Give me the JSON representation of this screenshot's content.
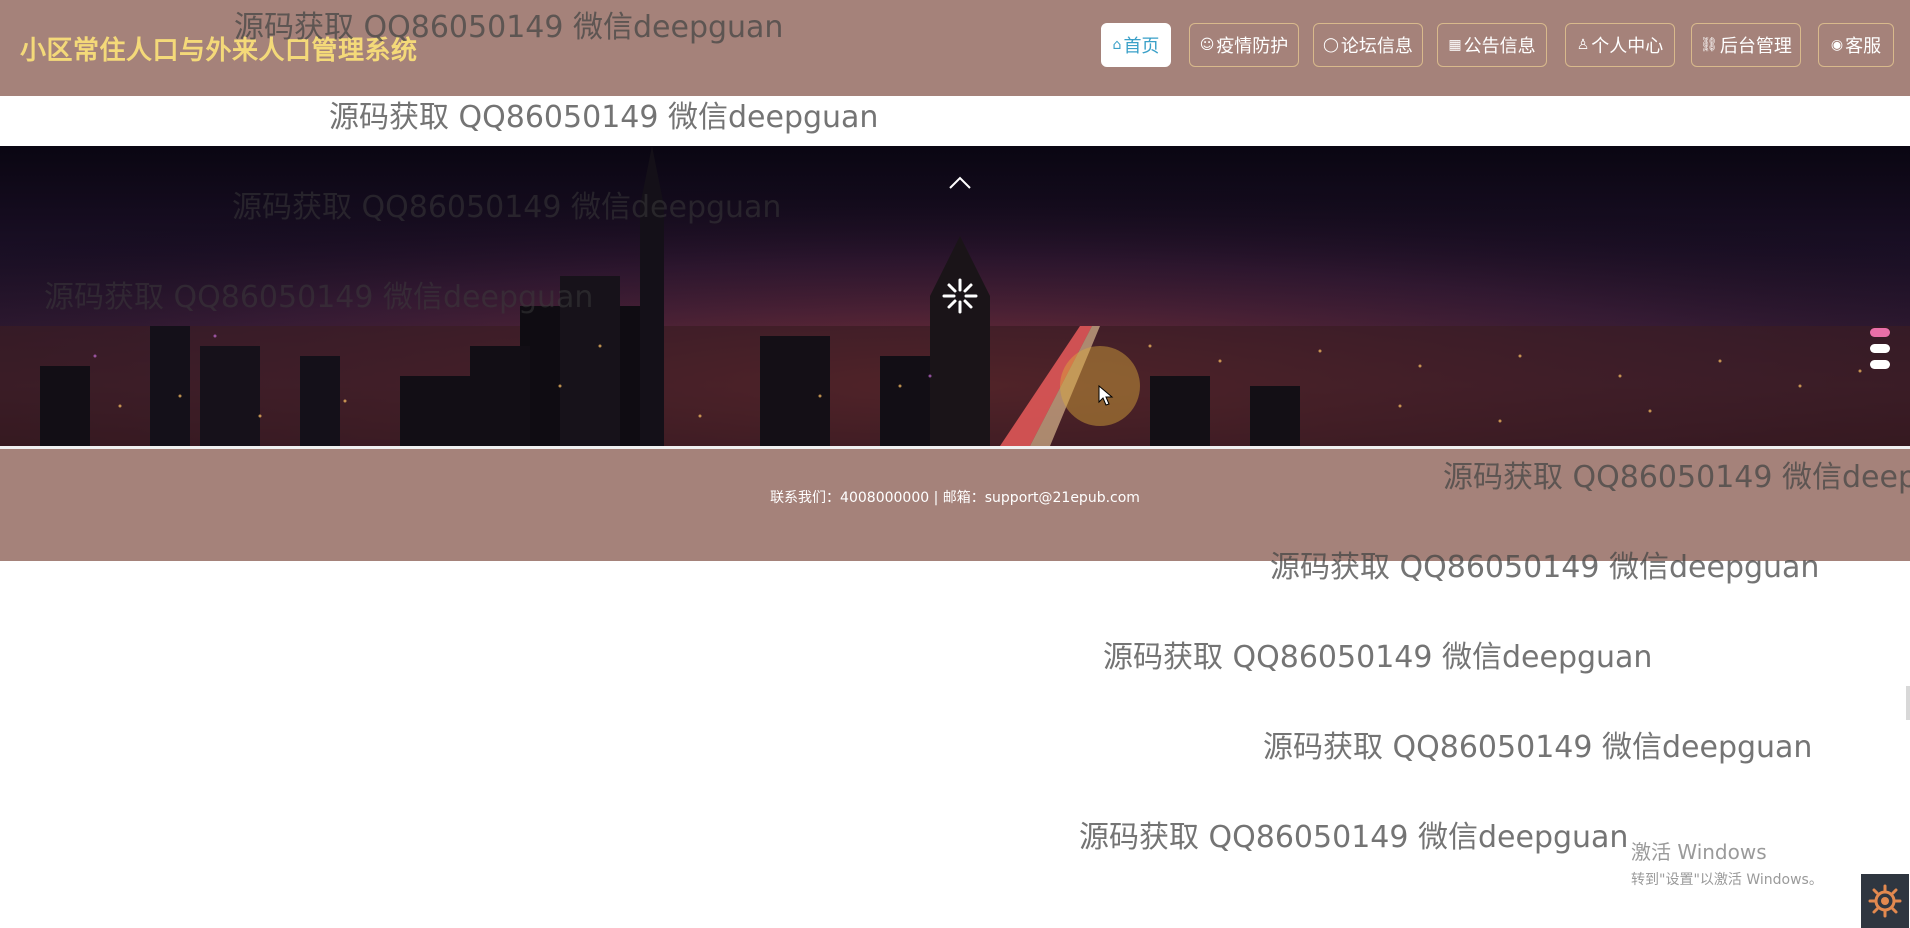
{
  "header": {
    "site_title": "小区常住人口与外来人口管理系统",
    "nav": [
      {
        "label": "首页",
        "icon": "home-icon",
        "active": true
      },
      {
        "label": "疫情防护",
        "icon": "shield-face-icon",
        "active": false
      },
      {
        "label": "论坛信息",
        "icon": "chat-bubble-icon",
        "active": false
      },
      {
        "label": "公告信息",
        "icon": "grid-icon",
        "active": false
      },
      {
        "label": "个人中心",
        "icon": "user-icon",
        "active": false
      },
      {
        "label": "后台管理",
        "icon": "link-icon",
        "active": false
      },
      {
        "label": "客服",
        "icon": "headset-icon",
        "active": false
      }
    ]
  },
  "banner": {
    "scene": "night city skyline",
    "carousel_indicators": 3,
    "active_indicator": 0
  },
  "footer": {
    "contact": "联系我们：4008000000 | 邮箱：support@21epub.com"
  },
  "watermark": {
    "text": "源码获取 QQ86050149 微信deepguan",
    "text_partial": "源码获取 QQ86050149 微信deep"
  },
  "system": {
    "windows_activate_title": "激活 Windows",
    "windows_activate_sub": "转到\"设置\"以激活 Windows。"
  },
  "colors": {
    "header_bg": "#a5827a",
    "title_color": "#f4d979",
    "active_nav_text": "#3aa0c8",
    "indicator_active": "#e96fa8"
  }
}
